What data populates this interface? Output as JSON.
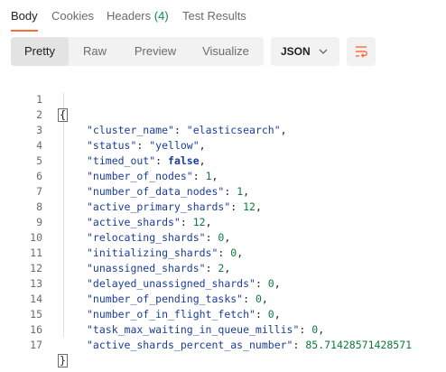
{
  "tabs": [
    {
      "label": "Body",
      "active": true
    },
    {
      "label": "Cookies",
      "active": false
    },
    {
      "label": "Headers",
      "count": "(4)",
      "active": false
    },
    {
      "label": "Test Results",
      "active": false
    }
  ],
  "toolbar": {
    "views": [
      "Pretty",
      "Raw",
      "Preview",
      "Visualize"
    ],
    "active_view": "Pretty",
    "format": "JSON",
    "format_icon": "chevron-down-icon",
    "wrap_icon": "wrap-lines-icon"
  },
  "code": {
    "line_numbers": [
      "1",
      "2",
      "3",
      "4",
      "5",
      "6",
      "7",
      "8",
      "9",
      "10",
      "11",
      "12",
      "13",
      "14",
      "15",
      "16",
      "17"
    ],
    "open_brace": "{",
    "close_brace": "}",
    "entries": [
      {
        "key": "\"cluster_name\"",
        "value": "\"elasticsearch\"",
        "type": "string"
      },
      {
        "key": "\"status\"",
        "value": "\"yellow\"",
        "type": "string"
      },
      {
        "key": "\"timed_out\"",
        "value": "false",
        "type": "bool"
      },
      {
        "key": "\"number_of_nodes\"",
        "value": "1",
        "type": "number"
      },
      {
        "key": "\"number_of_data_nodes\"",
        "value": "1",
        "type": "number"
      },
      {
        "key": "\"active_primary_shards\"",
        "value": "12",
        "type": "number"
      },
      {
        "key": "\"active_shards\"",
        "value": "12",
        "type": "number"
      },
      {
        "key": "\"relocating_shards\"",
        "value": "0",
        "type": "number"
      },
      {
        "key": "\"initializing_shards\"",
        "value": "0",
        "type": "number"
      },
      {
        "key": "\"unassigned_shards\"",
        "value": "2",
        "type": "number"
      },
      {
        "key": "\"delayed_unassigned_shards\"",
        "value": "0",
        "type": "number"
      },
      {
        "key": "\"number_of_pending_tasks\"",
        "value": "0",
        "type": "number"
      },
      {
        "key": "\"number_of_in_flight_fetch\"",
        "value": "0",
        "type": "number"
      },
      {
        "key": "\"task_max_waiting_in_queue_millis\"",
        "value": "0",
        "type": "number"
      },
      {
        "key": "\"active_shards_percent_as_number\"",
        "value": "85.71428571428571",
        "type": "number"
      }
    ]
  },
  "colors": {
    "accent": "#ff6c37",
    "key": "#1a3d99",
    "number": "#0d7a3a",
    "count": "#0f8a4b"
  }
}
